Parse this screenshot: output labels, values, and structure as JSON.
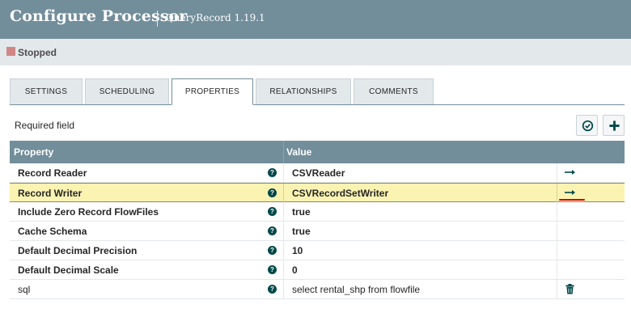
{
  "dialog": {
    "title": "Configure Processor",
    "subtitle": "QueryRecord 1.19.1"
  },
  "status": {
    "text": "Stopped",
    "icon": "stop-square-icon",
    "color": "#d18686"
  },
  "tabs": [
    {
      "label": "SETTINGS"
    },
    {
      "label": "SCHEDULING"
    },
    {
      "label": "PROPERTIES",
      "active": true
    },
    {
      "label": "RELATIONSHIPS"
    },
    {
      "label": "COMMENTS"
    }
  ],
  "properties": {
    "required_label": "Required field",
    "verify_icon": "check-circle-icon",
    "add_icon": "plus-icon",
    "columns": {
      "property": "Property",
      "value": "Value"
    },
    "rows": [
      {
        "name": "Record Reader",
        "value": "CSVReader",
        "action": "arrow-right-icon",
        "required": true
      },
      {
        "name": "Record Writer",
        "value": "CSVRecordSetWriter",
        "action": "arrow-right-icon",
        "required": true,
        "selected": true
      },
      {
        "name": "Include Zero Record FlowFiles",
        "value": "true",
        "required": true
      },
      {
        "name": "Cache Schema",
        "value": "true",
        "required": true
      },
      {
        "name": "Default Decimal Precision",
        "value": "10",
        "required": true
      },
      {
        "name": "Default Decimal Scale",
        "value": "0",
        "required": true
      },
      {
        "name": "sql",
        "value": "select rental_shp from flowfile",
        "action": "trash-icon",
        "required": false
      }
    ]
  },
  "colors": {
    "header": "#728e9b",
    "accent": "#004849",
    "selected_row": "#fbf3b2",
    "annotation": "#cc0000"
  }
}
